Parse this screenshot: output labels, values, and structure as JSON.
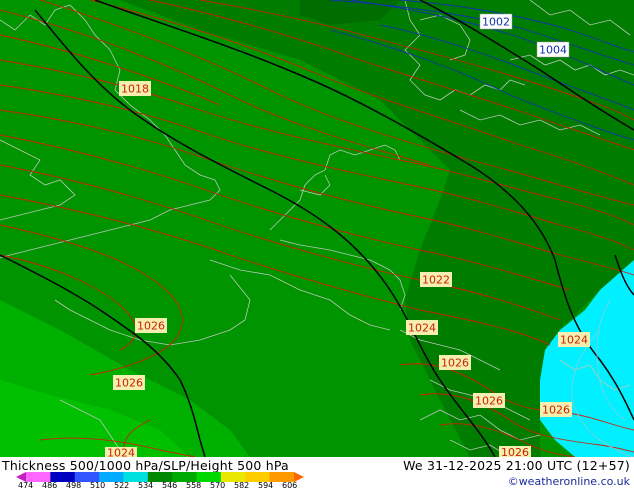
{
  "footer": {
    "title": "Thickness 500/1000 hPa/SLP/Height 500 hPa",
    "datetime": "We 31-12-2025 21:00 UTC (12+57)",
    "credit": "©weatheronline.co.uk"
  },
  "colorbar": {
    "ticks": [
      "474",
      "486",
      "498",
      "510",
      "522",
      "534",
      "546",
      "558",
      "570",
      "582",
      "594",
      "606"
    ],
    "colors": [
      "#c020c0",
      "#ff66ff",
      "#0000c0",
      "#3355ff",
      "#00aaff",
      "#00e0e0",
      "#008800",
      "#00aa00",
      "#00d800",
      "#e8e800",
      "#ffcc00",
      "#ff9900",
      "#ff6600"
    ]
  },
  "map": {
    "pressure_labels": [
      {
        "text": "1002",
        "color": "#1133aa"
      },
      {
        "text": "1004",
        "color": "#1133aa"
      },
      {
        "text": "1018",
        "color": "#cc2200"
      },
      {
        "text": "1022",
        "color": "#cc2200"
      },
      {
        "text": "1024",
        "color": "#cc2200"
      },
      {
        "text": "1024",
        "color": "#cc2200"
      },
      {
        "text": "1026",
        "color": "#cc2200"
      },
      {
        "text": "1026",
        "color": "#cc2200"
      },
      {
        "text": "1026",
        "color": "#cc2200"
      },
      {
        "text": "1026",
        "color": "#cc2200"
      },
      {
        "text": "1026",
        "color": "#cc2200"
      },
      {
        "text": "1026",
        "color": "#cc2200"
      },
      {
        "text": "1024",
        "color": "#cc2200"
      }
    ],
    "colors": {
      "thickness_dark": "#007c00",
      "thickness_mid": "#009400",
      "thickness_light": "#00b000",
      "thickness_lightest": "#00c000",
      "thickness_cyan": "#00f0ff",
      "isobar_red": "#cc2200",
      "isobar_blue": "#1133aa",
      "height_black": "#000000",
      "coastline": "#b8c8b8"
    }
  }
}
